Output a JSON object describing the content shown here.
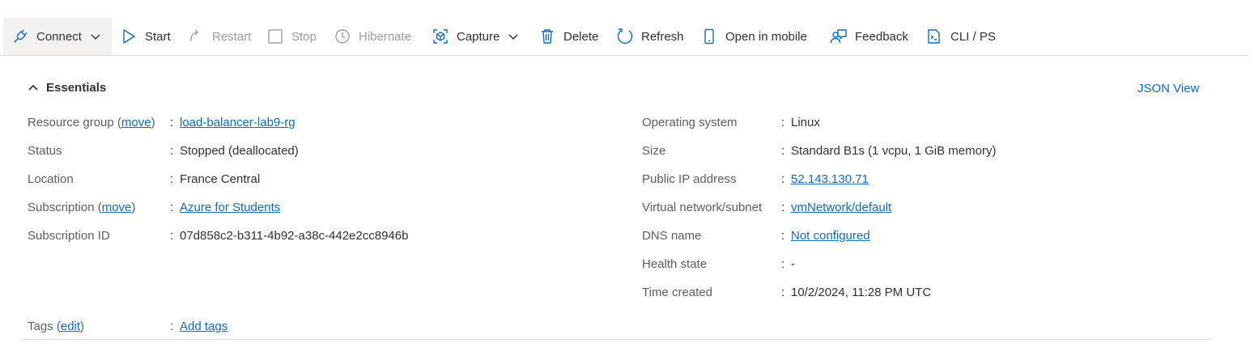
{
  "toolbar": {
    "connect": "Connect",
    "start": "Start",
    "restart": "Restart",
    "stop": "Stop",
    "hibernate": "Hibernate",
    "capture": "Capture",
    "delete": "Delete",
    "refresh": "Refresh",
    "open_in_mobile": "Open in mobile",
    "feedback": "Feedback",
    "cli_ps": "CLI / PS"
  },
  "essentials": {
    "title": "Essentials",
    "json_view": "JSON View",
    "left": {
      "resource_group_label": "Resource group",
      "move_link": "move",
      "resource_group_value": "load-balancer-lab9-rg",
      "status_label": "Status",
      "status_value": "Stopped (deallocated)",
      "location_label": "Location",
      "location_value": "France Central",
      "subscription_label": "Subscription",
      "subscription_move_link": "move",
      "subscription_value": "Azure for Students",
      "subscription_id_label": "Subscription ID",
      "subscription_id_value": "07d858c2-b311-4b92-a38c-442e2cc8946b"
    },
    "right": {
      "os_label": "Operating system",
      "os_value": "Linux",
      "size_label": "Size",
      "size_value": "Standard B1s (1 vcpu, 1 GiB memory)",
      "public_ip_label": "Public IP address",
      "public_ip_value": "52.143.130.71",
      "vnet_label": "Virtual network/subnet",
      "vnet_value": "vmNetwork/default",
      "dns_label": "DNS name",
      "dns_value": "Not configured",
      "health_label": "Health state",
      "health_value": "-",
      "time_created_label": "Time created",
      "time_created_value": "10/2/2024, 11:28 PM UTC"
    },
    "tags": {
      "label": "Tags",
      "edit_link": "edit",
      "value": "Add tags"
    },
    "separator": ":"
  },
  "colors": {
    "accent": "#0f6cbd",
    "disabled": "#a19f9d",
    "text": "#323130",
    "label": "#605e5c"
  }
}
